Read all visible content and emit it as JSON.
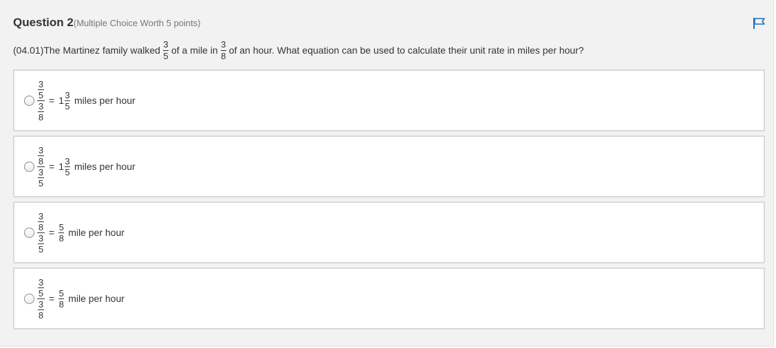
{
  "question": {
    "title": "Question 2",
    "worth": "(Multiple Choice Worth 5 points)",
    "prefix": "(04.01)The Martinez family walked",
    "frac1": {
      "num": "3",
      "den": "5"
    },
    "mid": "of a mile in",
    "frac2": {
      "num": "3",
      "den": "8"
    },
    "suffix": "of an hour. What equation can be used to calculate their unit rate in miles per hour?",
    "flag_icon": "flag-icon"
  },
  "options": [
    {
      "top": {
        "num": "3",
        "den": "5"
      },
      "bottom": {
        "num": "3",
        "den": "8"
      },
      "equals": "=",
      "whole": "1",
      "result": {
        "num": "3",
        "den": "5"
      },
      "unit": "miles per hour"
    },
    {
      "top": {
        "num": "3",
        "den": "8"
      },
      "bottom": {
        "num": "3",
        "den": "5"
      },
      "equals": "=",
      "whole": "1",
      "result": {
        "num": "3",
        "den": "5"
      },
      "unit": "miles per hour"
    },
    {
      "top": {
        "num": "3",
        "den": "8"
      },
      "bottom": {
        "num": "3",
        "den": "5"
      },
      "equals": "=",
      "whole": "",
      "result": {
        "num": "5",
        "den": "8"
      },
      "unit": "mile per hour"
    },
    {
      "top": {
        "num": "3",
        "den": "5"
      },
      "bottom": {
        "num": "3",
        "den": "8"
      },
      "equals": "=",
      "whole": "",
      "result": {
        "num": "5",
        "den": "8"
      },
      "unit": "mile per hour"
    }
  ]
}
